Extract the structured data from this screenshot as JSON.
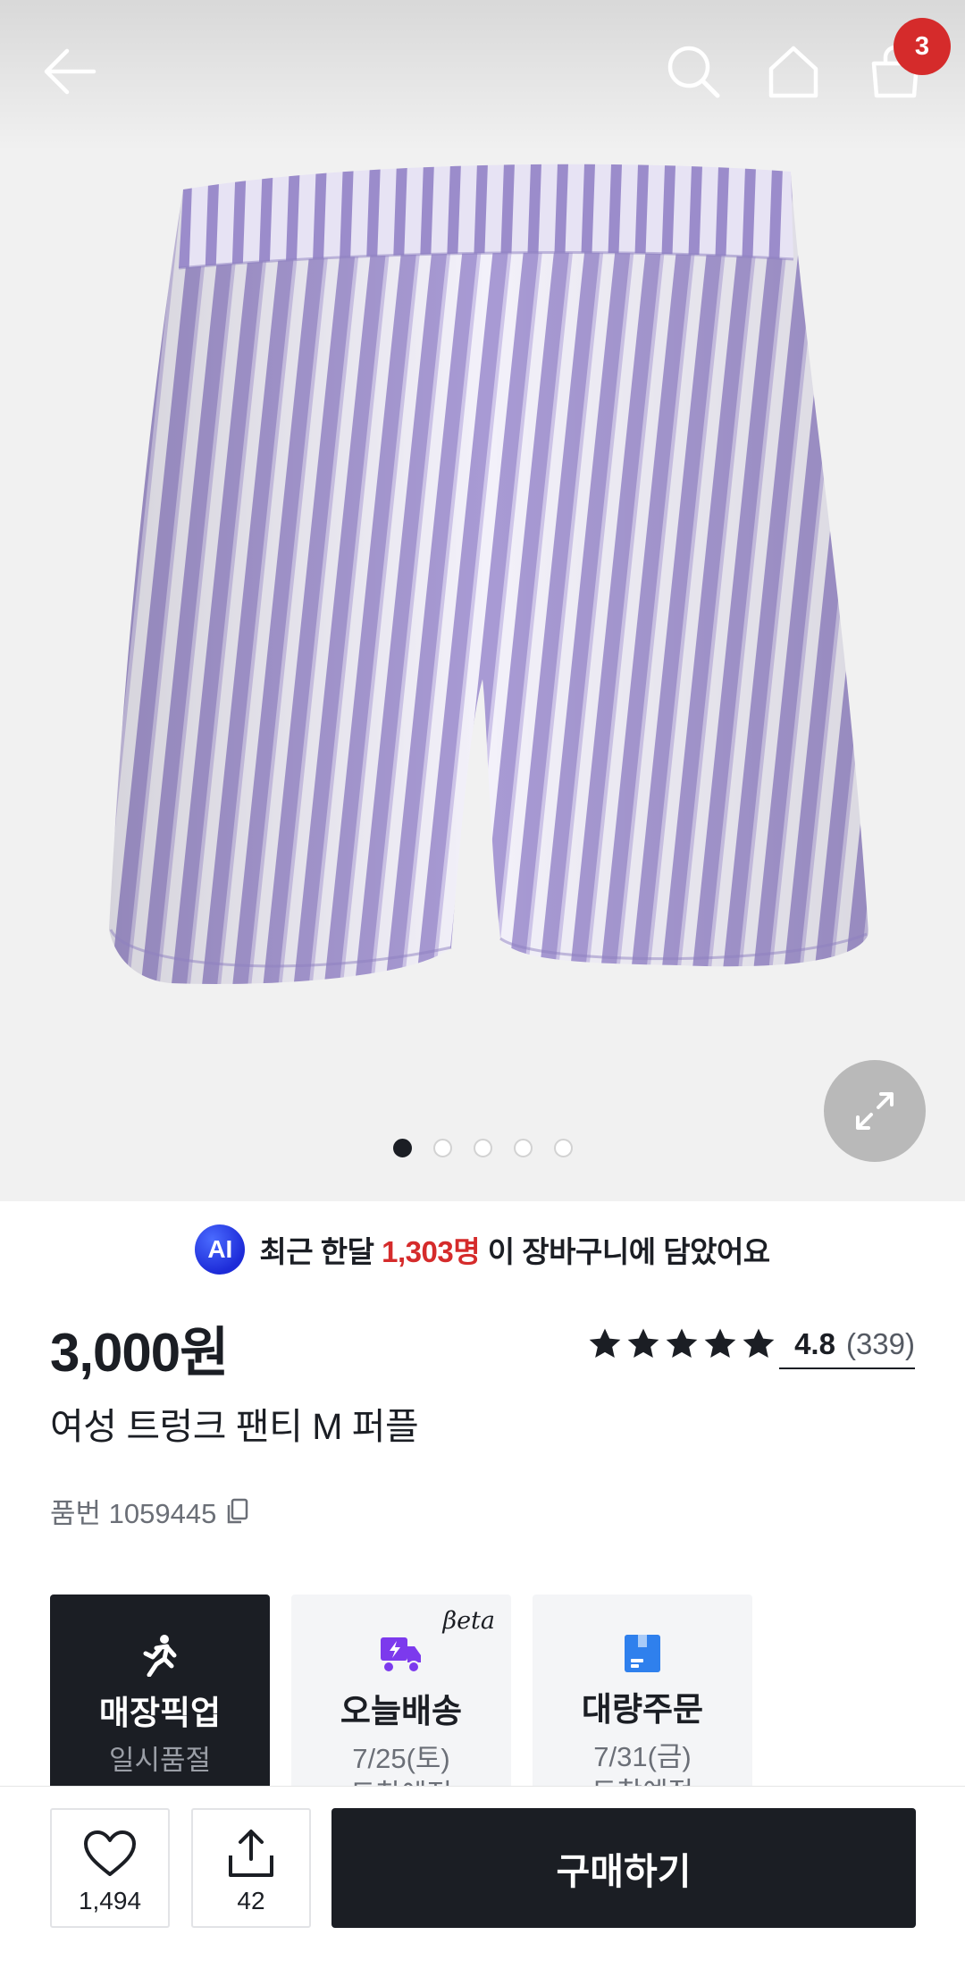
{
  "header": {
    "back_icon": "arrow-left-icon",
    "search_icon": "search-icon",
    "home_icon": "home-icon",
    "cart_icon": "shopping-bag-icon",
    "cart_count": "3"
  },
  "gallery": {
    "image": "purple-striped-trunk-shorts",
    "image_count": 5,
    "current_index": 1,
    "zoom_icon": "expand-icon"
  },
  "ai_banner": {
    "badge": "AI",
    "prefix": "최근 한달",
    "count": "1,303명",
    "suffix": "이 장바구니에 담았어요"
  },
  "product": {
    "price": "3,000원",
    "name": "여성 트렁크 팬티 M 퍼플",
    "sku_label": "품번 1059445",
    "rating": {
      "score": "4.8",
      "count": "(339)",
      "stars": 5
    }
  },
  "delivery_options": [
    {
      "title": "매장픽업",
      "line1": "일시품절",
      "line2": "",
      "icon": "runner-icon",
      "selected": true
    },
    {
      "title": "오늘배송",
      "line1": "7/25(토)",
      "line2": "도착예정",
      "icon": "delivery-scooter-icon",
      "tag": "βeta"
    },
    {
      "title": "대량주문",
      "line1": "7/31(금)",
      "line2": "도착예정",
      "icon": "box-icon"
    }
  ],
  "bottom_bar": {
    "like_count": "1,494",
    "share_count": "42",
    "buy_label": "구매하기"
  },
  "colors": {
    "accent_red": "#d52b2b",
    "dark": "#1b1e24",
    "ai_blue": "#1d2bd8",
    "delivery_purple": "#7c3aed",
    "bulk_blue": "#2f80ed"
  }
}
